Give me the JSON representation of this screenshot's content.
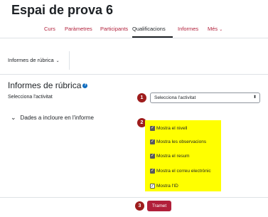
{
  "course": {
    "title": "Espai de prova 6"
  },
  "nav": {
    "tabs": [
      {
        "label": "Curs"
      },
      {
        "label": "Paràmetres"
      },
      {
        "label": "Participants"
      },
      {
        "label": "Qualificacions",
        "active": true
      },
      {
        "label": "Informes"
      },
      {
        "label": "Més"
      }
    ]
  },
  "report_selector": {
    "label": "Informes de rúbrica"
  },
  "page": {
    "title": "Informes de rúbrica",
    "activity_label": "Selecciona l'activitat",
    "activity_select": {
      "selected": "Selecciona l'activitat"
    },
    "section": {
      "label": "Dades a incloure en l'informe"
    },
    "checkboxes": [
      {
        "label": "Mostra el nivell",
        "checked": true
      },
      {
        "label": "Mostra les observacions",
        "checked": true
      },
      {
        "label": "Mostra el resum",
        "checked": true
      },
      {
        "label": "Mostra el correu electrònic",
        "checked": true
      },
      {
        "label": "Mostra l'ID",
        "checked": true
      }
    ],
    "submit_label": "Tramet"
  },
  "markers": [
    "1",
    "2",
    "3"
  ],
  "colors": {
    "accent": "#b11f3a",
    "marker": "#9e1c1c",
    "highlight": "#ffff00",
    "help": "#0f6cbf"
  }
}
